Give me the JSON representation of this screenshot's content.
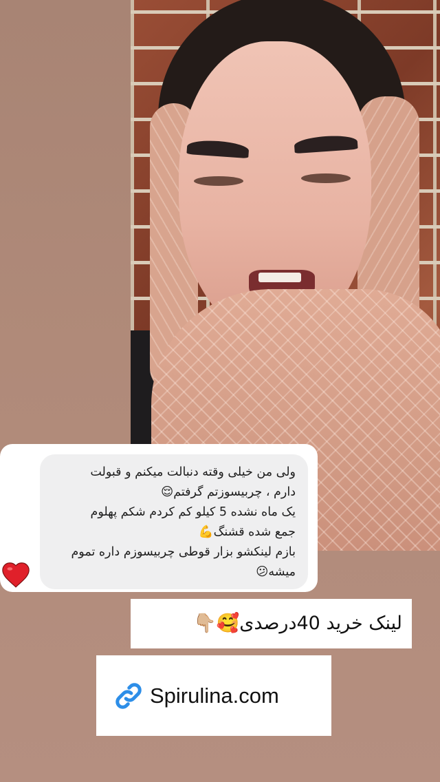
{
  "chat_message": {
    "lines": [
      "ولی من خیلی وقته دنبالت میکنم و قبولت",
      "دارم ، چربیسوزتم گرفتم😌",
      "یک ماه نشده 5 کیلو کم کردم شکم پهلوم",
      "جمع شده قشنگ💪",
      "بازم لینکشو بزار قوطی چربیسوزم داره تموم",
      "میشه😕"
    ]
  },
  "reaction": {
    "icon": "heart-icon",
    "color": "#e0202a"
  },
  "link_label": "لینک خرید 40درصدی🥰👇🏼",
  "link_sticker": {
    "icon": "link-icon",
    "text": "Spirulina.com",
    "icon_color": "#2d8ee8"
  }
}
